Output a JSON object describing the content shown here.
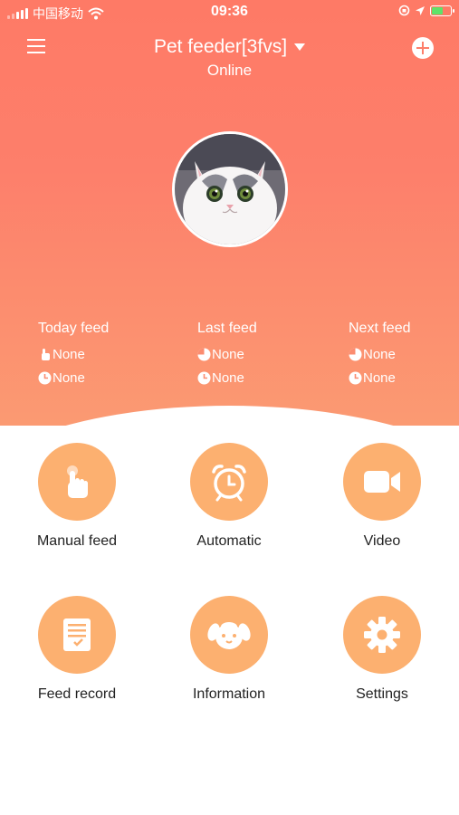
{
  "status_bar": {
    "carrier": "中国移动",
    "time": "09:36"
  },
  "header": {
    "title": "Pet feeder[3fvs]",
    "subtitle": "Online"
  },
  "feed": [
    {
      "label": "Today feed",
      "line1": "None",
      "line2": "None"
    },
    {
      "label": "Last feed",
      "line1": "None",
      "line2": "None"
    },
    {
      "label": "Next feed",
      "line1": "None",
      "line2": "None"
    }
  ],
  "actions": [
    {
      "label": "Manual feed",
      "icon": "hand-tap-icon"
    },
    {
      "label": "Automatic",
      "icon": "alarm-clock-icon"
    },
    {
      "label": "Video",
      "icon": "video-camera-icon"
    },
    {
      "label": "Feed record",
      "icon": "clipboard-icon"
    },
    {
      "label": "Information",
      "icon": "dog-face-icon"
    },
    {
      "label": "Settings",
      "icon": "gear-icon"
    }
  ],
  "colors": {
    "primary": "#fd7f6b",
    "accent": "#fcb070",
    "battery": "#5ee26a"
  }
}
